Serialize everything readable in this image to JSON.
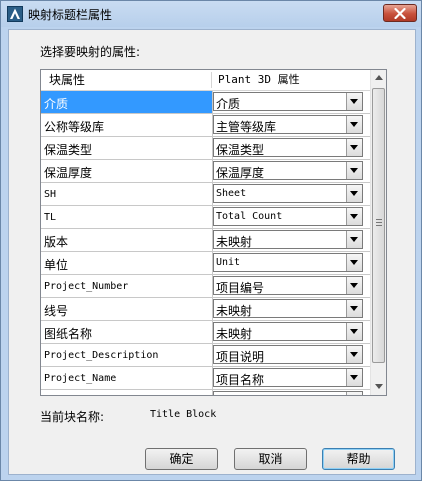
{
  "window": {
    "title": "映射标题栏属性"
  },
  "prompt_label": "选择要映射的属性:",
  "grid": {
    "columns": [
      "块属性",
      "Plant 3D 属性"
    ],
    "rows": [
      {
        "attr": "介质",
        "value": "介质",
        "mono_attr": false,
        "mono_value": false,
        "selected": true
      },
      {
        "attr": "公称等级库",
        "value": "主管等级库",
        "mono_attr": false,
        "mono_value": false,
        "selected": false
      },
      {
        "attr": "保温类型",
        "value": "保温类型",
        "mono_attr": false,
        "mono_value": false,
        "selected": false
      },
      {
        "attr": "保温厚度",
        "value": "保温厚度",
        "mono_attr": false,
        "mono_value": false,
        "selected": false
      },
      {
        "attr": "SH",
        "value": "Sheet",
        "mono_attr": true,
        "mono_value": true,
        "selected": false
      },
      {
        "attr": "TL",
        "value": "Total Count",
        "mono_attr": true,
        "mono_value": true,
        "selected": false
      },
      {
        "attr": "版本",
        "value": "未映射",
        "mono_attr": false,
        "mono_value": false,
        "selected": false
      },
      {
        "attr": "单位",
        "value": "Unit",
        "mono_attr": false,
        "mono_value": true,
        "selected": false
      },
      {
        "attr": "Project_Number",
        "value": "项目编号",
        "mono_attr": true,
        "mono_value": false,
        "selected": false
      },
      {
        "attr": "线号",
        "value": "未映射",
        "mono_attr": false,
        "mono_value": false,
        "selected": false
      },
      {
        "attr": "图纸名称",
        "value": "未映射",
        "mono_attr": false,
        "mono_value": false,
        "selected": false
      },
      {
        "attr": "Project_Description",
        "value": "项目说明",
        "mono_attr": true,
        "mono_value": false,
        "selected": false
      },
      {
        "attr": "Project_Name",
        "value": "项目名称",
        "mono_attr": true,
        "mono_value": false,
        "selected": false
      },
      {
        "attr": "",
        "value": "",
        "mono_attr": false,
        "mono_value": false,
        "selected": false
      }
    ]
  },
  "current_block": {
    "label": "当前块名称:",
    "value": "Title Block"
  },
  "buttons": {
    "ok": "确定",
    "cancel": "取消",
    "help": "帮助"
  },
  "colors": {
    "selection": "#3399ff",
    "titlebar": "#b7cfeb",
    "close_button": "#c8513c"
  },
  "icons": {
    "app": "autocad-a-icon",
    "close": "close-icon",
    "dropdown": "chevron-down-icon"
  }
}
